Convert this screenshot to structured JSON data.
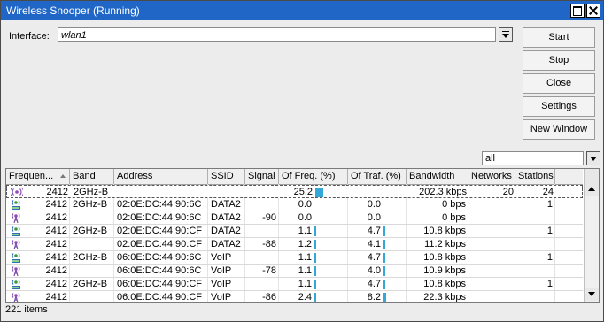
{
  "window": {
    "title": "Wireless Snooper (Running)"
  },
  "interface": {
    "label": "Interface:",
    "value": "wlan1"
  },
  "buttons": {
    "start": "Start",
    "stop": "Stop",
    "close": "Close",
    "settings": "Settings",
    "new_window": "New Window"
  },
  "filter": {
    "value": "all"
  },
  "table": {
    "columns": [
      "Frequen...",
      "Band",
      "Address",
      "SSID",
      "Signal",
      "Of Freq. (%)",
      "Of Traf. (%)",
      "Bandwidth",
      "Networks",
      "Stations"
    ],
    "rows": [
      {
        "icon": "frequency-icon",
        "freq": "2412",
        "band": "2GHz-B",
        "address": "",
        "ssid": "",
        "signal": "",
        "of_freq": "25.2",
        "of_freq_pct": 25.2,
        "of_traf": "",
        "of_traf_pct": 0,
        "bandwidth": "202.3 kbps",
        "networks": "20",
        "stations": "24"
      },
      {
        "icon": "network-icon",
        "freq": "2412",
        "band": "2GHz-B",
        "address": "02:0E:DC:44:90:6C",
        "ssid": "DATA2",
        "signal": "",
        "of_freq": "0.0",
        "of_freq_pct": 0,
        "of_traf": "0.0",
        "of_traf_pct": 0,
        "bandwidth": "0 bps",
        "networks": "",
        "stations": "1"
      },
      {
        "icon": "station-icon",
        "freq": "2412",
        "band": "",
        "address": "02:0E:DC:44:90:6C",
        "ssid": "DATA2",
        "signal": "-90",
        "of_freq": "0.0",
        "of_freq_pct": 0,
        "of_traf": "0.0",
        "of_traf_pct": 0,
        "bandwidth": "0 bps",
        "networks": "",
        "stations": ""
      },
      {
        "icon": "network-icon",
        "freq": "2412",
        "band": "2GHz-B",
        "address": "02:0E:DC:44:90:CF",
        "ssid": "DATA2",
        "signal": "",
        "of_freq": "1.1",
        "of_freq_pct": 1.1,
        "of_traf": "4.7",
        "of_traf_pct": 4.7,
        "bandwidth": "10.8 kbps",
        "networks": "",
        "stations": "1"
      },
      {
        "icon": "station-icon",
        "freq": "2412",
        "band": "",
        "address": "02:0E:DC:44:90:CF",
        "ssid": "DATA2",
        "signal": "-88",
        "of_freq": "1.2",
        "of_freq_pct": 1.2,
        "of_traf": "4.1",
        "of_traf_pct": 4.1,
        "bandwidth": "11.2 kbps",
        "networks": "",
        "stations": ""
      },
      {
        "icon": "network-icon",
        "freq": "2412",
        "band": "2GHz-B",
        "address": "06:0E:DC:44:90:6C",
        "ssid": "VoIP",
        "signal": "",
        "of_freq": "1.1",
        "of_freq_pct": 1.1,
        "of_traf": "4.7",
        "of_traf_pct": 4.7,
        "bandwidth": "10.8 kbps",
        "networks": "",
        "stations": "1"
      },
      {
        "icon": "station-icon",
        "freq": "2412",
        "band": "",
        "address": "06:0E:DC:44:90:6C",
        "ssid": "VoIP",
        "signal": "-78",
        "of_freq": "1.1",
        "of_freq_pct": 1.1,
        "of_traf": "4.0",
        "of_traf_pct": 4.0,
        "bandwidth": "10.9 kbps",
        "networks": "",
        "stations": ""
      },
      {
        "icon": "network-icon",
        "freq": "2412",
        "band": "2GHz-B",
        "address": "06:0E:DC:44:90:CF",
        "ssid": "VoIP",
        "signal": "",
        "of_freq": "1.1",
        "of_freq_pct": 1.1,
        "of_traf": "4.7",
        "of_traf_pct": 4.7,
        "bandwidth": "10.8 kbps",
        "networks": "",
        "stations": "1"
      },
      {
        "icon": "station-icon",
        "freq": "2412",
        "band": "",
        "address": "06:0E:DC:44:90:CF",
        "ssid": "VoIP",
        "signal": "-86",
        "of_freq": "2.4",
        "of_freq_pct": 2.4,
        "of_traf": "8.2",
        "of_traf_pct": 8.2,
        "bandwidth": "22.3 kbps",
        "networks": "",
        "stations": ""
      }
    ]
  },
  "status": {
    "items": "221 items"
  },
  "colors": {
    "titlebar": "#1f66c7",
    "gauge": "#33a7d8"
  }
}
